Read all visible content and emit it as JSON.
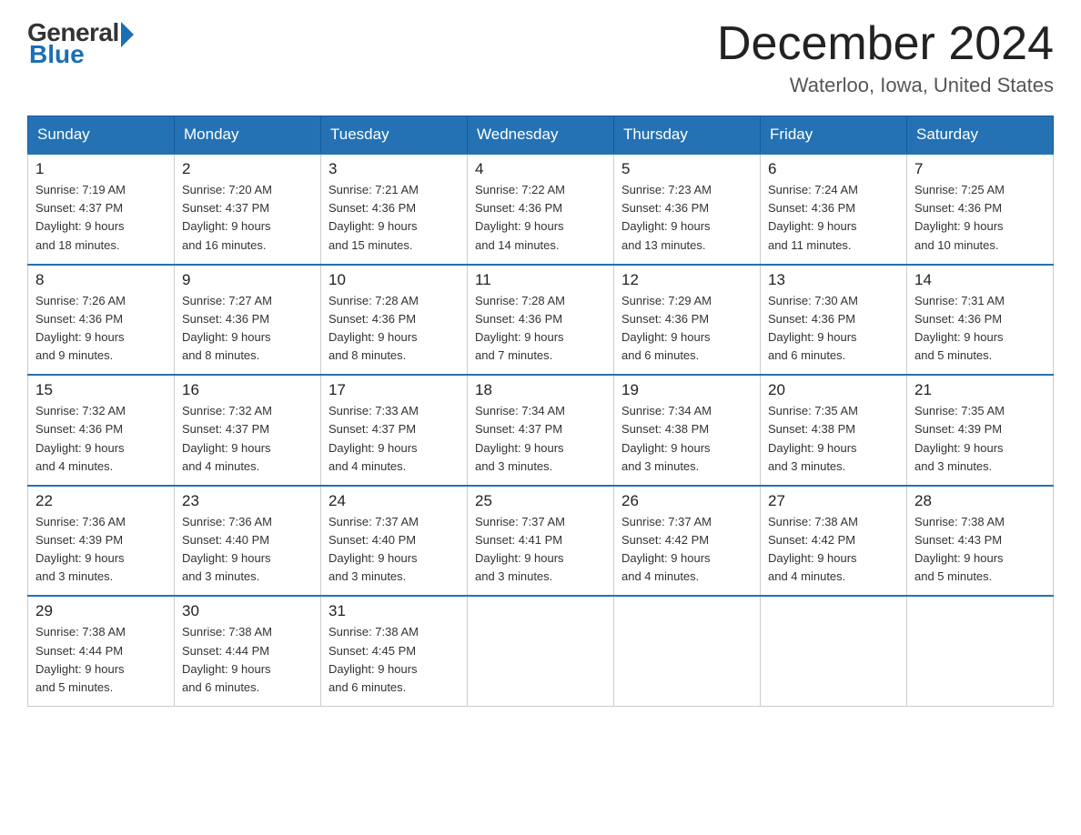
{
  "logo": {
    "general": "General",
    "blue": "Blue"
  },
  "header": {
    "month": "December 2024",
    "location": "Waterloo, Iowa, United States"
  },
  "days_of_week": [
    "Sunday",
    "Monday",
    "Tuesday",
    "Wednesday",
    "Thursday",
    "Friday",
    "Saturday"
  ],
  "weeks": [
    [
      {
        "day": "1",
        "sunrise": "7:19 AM",
        "sunset": "4:37 PM",
        "daylight": "9 hours and 18 minutes."
      },
      {
        "day": "2",
        "sunrise": "7:20 AM",
        "sunset": "4:37 PM",
        "daylight": "9 hours and 16 minutes."
      },
      {
        "day": "3",
        "sunrise": "7:21 AM",
        "sunset": "4:36 PM",
        "daylight": "9 hours and 15 minutes."
      },
      {
        "day": "4",
        "sunrise": "7:22 AM",
        "sunset": "4:36 PM",
        "daylight": "9 hours and 14 minutes."
      },
      {
        "day": "5",
        "sunrise": "7:23 AM",
        "sunset": "4:36 PM",
        "daylight": "9 hours and 13 minutes."
      },
      {
        "day": "6",
        "sunrise": "7:24 AM",
        "sunset": "4:36 PM",
        "daylight": "9 hours and 11 minutes."
      },
      {
        "day": "7",
        "sunrise": "7:25 AM",
        "sunset": "4:36 PM",
        "daylight": "9 hours and 10 minutes."
      }
    ],
    [
      {
        "day": "8",
        "sunrise": "7:26 AM",
        "sunset": "4:36 PM",
        "daylight": "9 hours and 9 minutes."
      },
      {
        "day": "9",
        "sunrise": "7:27 AM",
        "sunset": "4:36 PM",
        "daylight": "9 hours and 8 minutes."
      },
      {
        "day": "10",
        "sunrise": "7:28 AM",
        "sunset": "4:36 PM",
        "daylight": "9 hours and 8 minutes."
      },
      {
        "day": "11",
        "sunrise": "7:28 AM",
        "sunset": "4:36 PM",
        "daylight": "9 hours and 7 minutes."
      },
      {
        "day": "12",
        "sunrise": "7:29 AM",
        "sunset": "4:36 PM",
        "daylight": "9 hours and 6 minutes."
      },
      {
        "day": "13",
        "sunrise": "7:30 AM",
        "sunset": "4:36 PM",
        "daylight": "9 hours and 6 minutes."
      },
      {
        "day": "14",
        "sunrise": "7:31 AM",
        "sunset": "4:36 PM",
        "daylight": "9 hours and 5 minutes."
      }
    ],
    [
      {
        "day": "15",
        "sunrise": "7:32 AM",
        "sunset": "4:36 PM",
        "daylight": "9 hours and 4 minutes."
      },
      {
        "day": "16",
        "sunrise": "7:32 AM",
        "sunset": "4:37 PM",
        "daylight": "9 hours and 4 minutes."
      },
      {
        "day": "17",
        "sunrise": "7:33 AM",
        "sunset": "4:37 PM",
        "daylight": "9 hours and 4 minutes."
      },
      {
        "day": "18",
        "sunrise": "7:34 AM",
        "sunset": "4:37 PM",
        "daylight": "9 hours and 3 minutes."
      },
      {
        "day": "19",
        "sunrise": "7:34 AM",
        "sunset": "4:38 PM",
        "daylight": "9 hours and 3 minutes."
      },
      {
        "day": "20",
        "sunrise": "7:35 AM",
        "sunset": "4:38 PM",
        "daylight": "9 hours and 3 minutes."
      },
      {
        "day": "21",
        "sunrise": "7:35 AM",
        "sunset": "4:39 PM",
        "daylight": "9 hours and 3 minutes."
      }
    ],
    [
      {
        "day": "22",
        "sunrise": "7:36 AM",
        "sunset": "4:39 PM",
        "daylight": "9 hours and 3 minutes."
      },
      {
        "day": "23",
        "sunrise": "7:36 AM",
        "sunset": "4:40 PM",
        "daylight": "9 hours and 3 minutes."
      },
      {
        "day": "24",
        "sunrise": "7:37 AM",
        "sunset": "4:40 PM",
        "daylight": "9 hours and 3 minutes."
      },
      {
        "day": "25",
        "sunrise": "7:37 AM",
        "sunset": "4:41 PM",
        "daylight": "9 hours and 3 minutes."
      },
      {
        "day": "26",
        "sunrise": "7:37 AM",
        "sunset": "4:42 PM",
        "daylight": "9 hours and 4 minutes."
      },
      {
        "day": "27",
        "sunrise": "7:38 AM",
        "sunset": "4:42 PM",
        "daylight": "9 hours and 4 minutes."
      },
      {
        "day": "28",
        "sunrise": "7:38 AM",
        "sunset": "4:43 PM",
        "daylight": "9 hours and 5 minutes."
      }
    ],
    [
      {
        "day": "29",
        "sunrise": "7:38 AM",
        "sunset": "4:44 PM",
        "daylight": "9 hours and 5 minutes."
      },
      {
        "day": "30",
        "sunrise": "7:38 AM",
        "sunset": "4:44 PM",
        "daylight": "9 hours and 6 minutes."
      },
      {
        "day": "31",
        "sunrise": "7:38 AM",
        "sunset": "4:45 PM",
        "daylight": "9 hours and 6 minutes."
      },
      null,
      null,
      null,
      null
    ]
  ],
  "labels": {
    "sunrise": "Sunrise:",
    "sunset": "Sunset:",
    "daylight": "Daylight:"
  }
}
